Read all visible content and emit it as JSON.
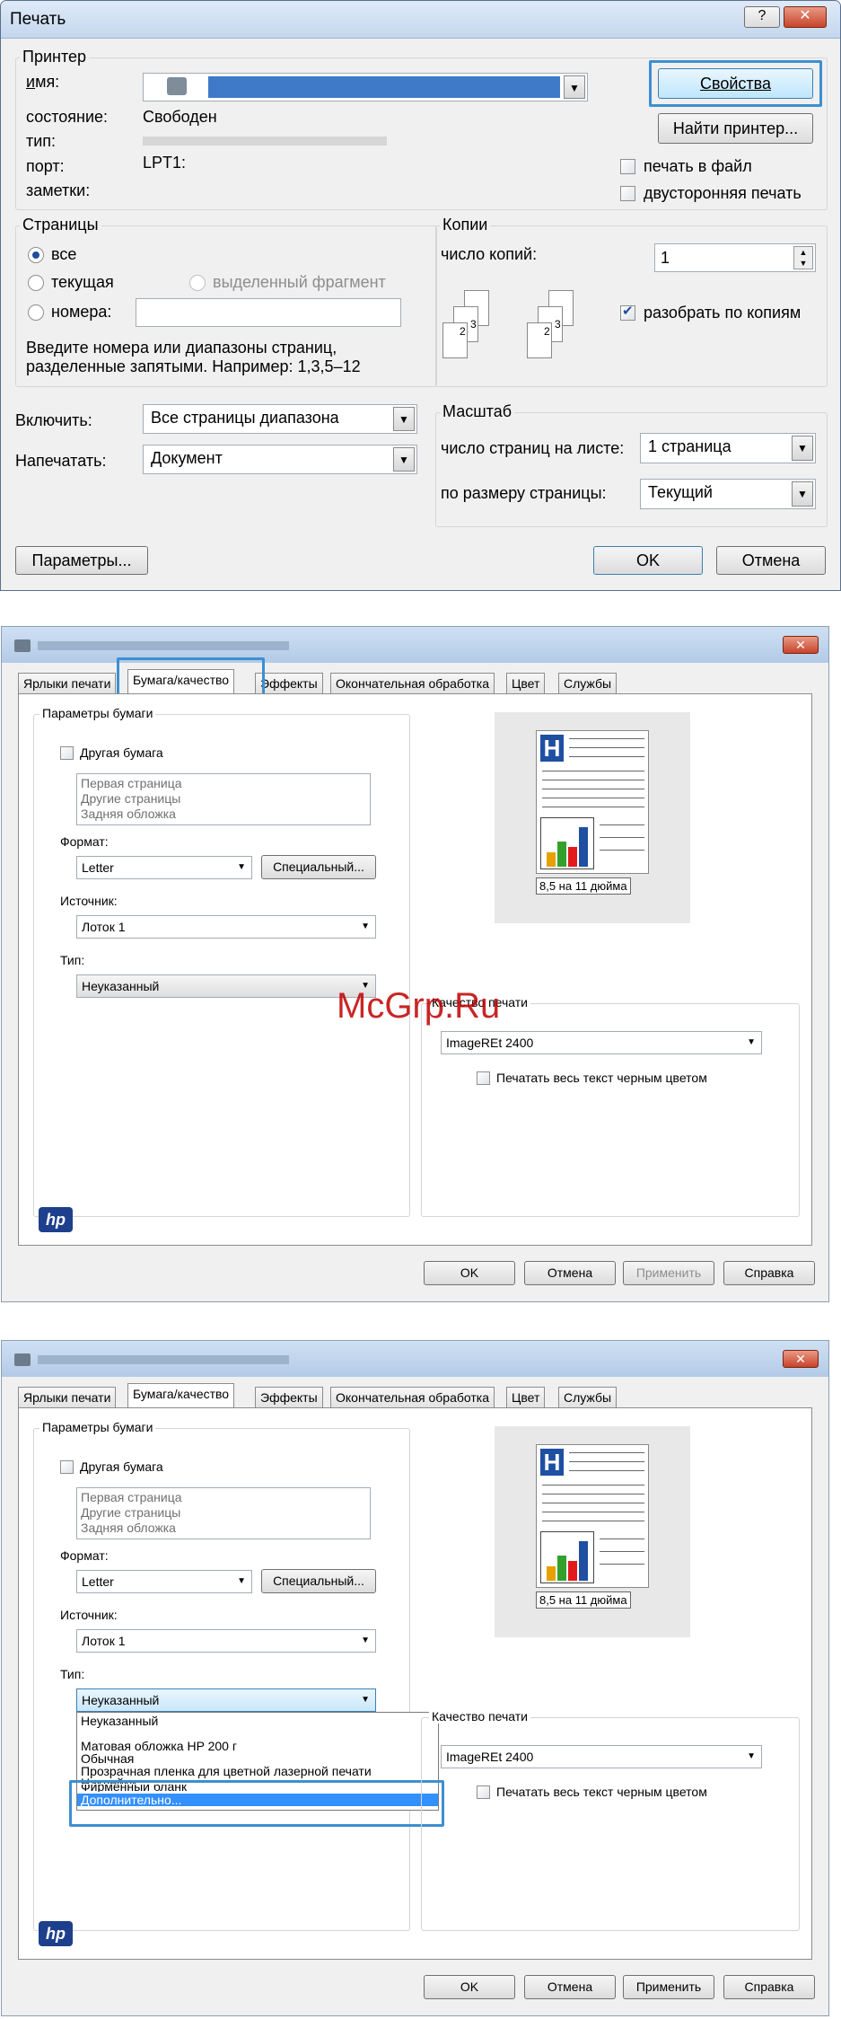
{
  "print_dialog": {
    "title": "Печать",
    "help_btn": "?",
    "close_btn": "✕",
    "printer_group": "Принтер",
    "name_label": "имя:",
    "status_label": "состояние:",
    "status_value": "Свободен",
    "type_label": "тип:",
    "port_label": "порт:",
    "port_value": "LPT1:",
    "notes_label": "заметки:",
    "properties_btn": "Свойства",
    "find_printer_btn": "Найти принтер...",
    "print_to_file": "печать в файл",
    "duplex": "двусторонняя печать",
    "pages_group": "Страницы",
    "all": "все",
    "current": "текущая",
    "selection": "выделенный фрагмент",
    "pages": "номера:",
    "pages_hint_1": "Введите номера или диапазоны страниц,",
    "pages_hint_2": "разделенные запятыми. Например: 1,3,5–12",
    "copies_group": "Копии",
    "copies_label": "число копий:",
    "copies_value": "1",
    "collate": "разобрать по копиям",
    "include_label": "Включить:",
    "include_value": "Все страницы диапазона",
    "print_what_label": "Напечатать:",
    "print_what_value": "Документ",
    "zoom_group": "Масштаб",
    "pages_per_sheet_label": "число страниц на листе:",
    "pages_per_sheet_value": "1 страница",
    "scale_label": "по размеру страницы:",
    "scale_value": "Текущий",
    "options_btn": "Параметры...",
    "ok_btn": "OK",
    "cancel_btn": "Отмена"
  },
  "props": {
    "tabs": [
      "Ярлыки печати",
      "Бумага/качество",
      "Эффекты",
      "Окончательная обработка",
      "Цвет",
      "Службы"
    ],
    "paper_group": "Параметры бумаги",
    "diff_paper": "Другая бумага",
    "list_items": [
      "Первая страница",
      "Другие страницы",
      "Задняя обложка"
    ],
    "size_label": "Формат:",
    "size_value": "Letter",
    "custom_btn": "Специальный...",
    "source_label": "Источник:",
    "source_value": "Лоток 1",
    "type_label": "Тип:",
    "type_value": "Неуказанный",
    "preview_caption": "8,5 на 11 дюйма",
    "quality_group": "Качество печати",
    "quality_value": "ImageREt 2400",
    "black_text": "Печатать весь текст черным цветом",
    "logo": "hp",
    "ok_btn": "OK",
    "cancel_btn": "Отмена",
    "apply_btn": "Применить",
    "help_btn": "Справка",
    "close_btn": "✕",
    "watermark": "McGrp.Ru",
    "type_dropdown": [
      "Неуказанный",
      "Матовая обложка HP 200 г",
      "Обычная",
      "Прозрачная пленка для цветной лазерной печати",
      "Наклейки",
      "Фирменный бланк",
      "Дополнительно..."
    ]
  }
}
